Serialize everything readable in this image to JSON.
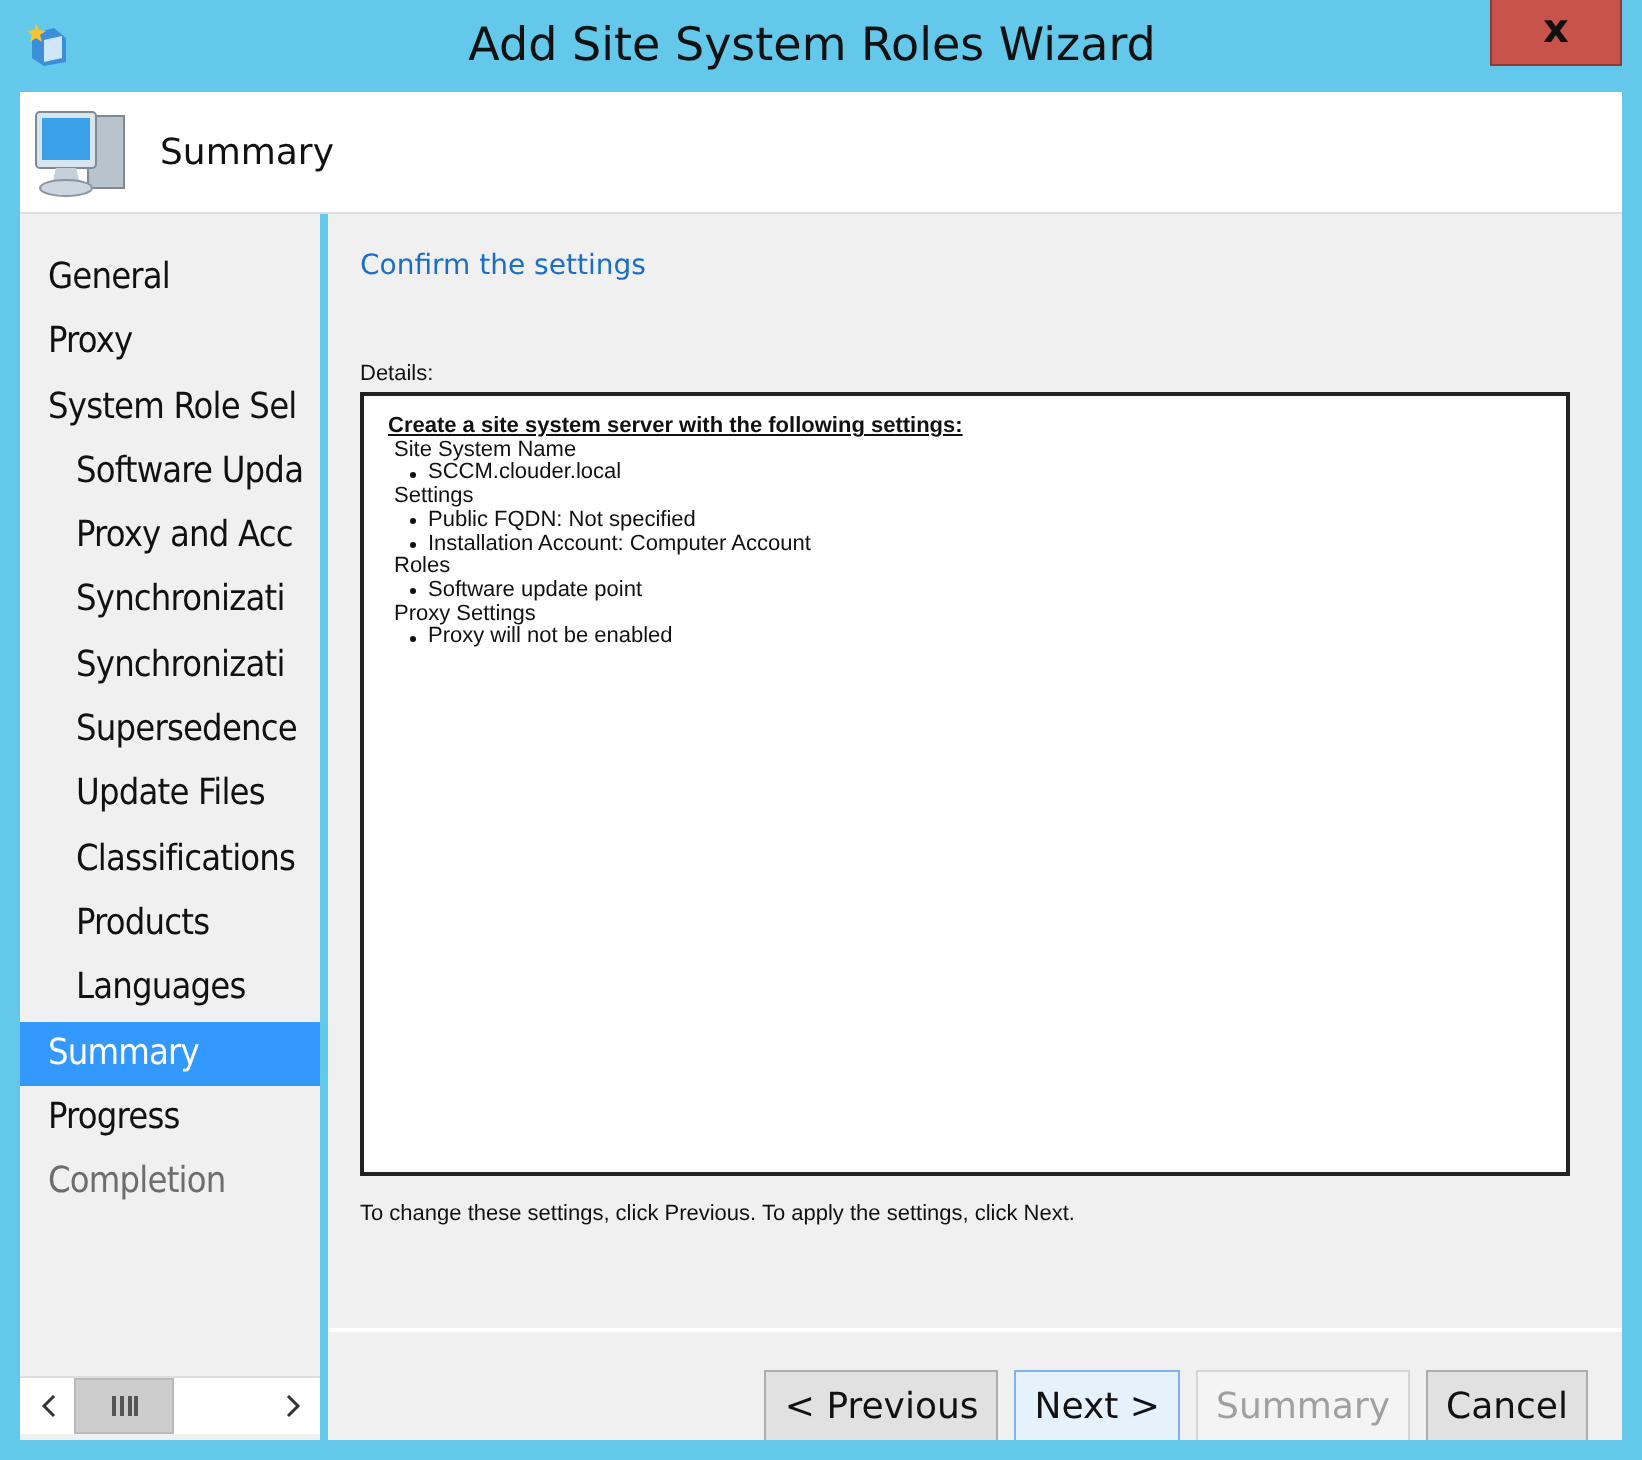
{
  "window": {
    "title": "Add Site System Roles Wizard",
    "close": "x"
  },
  "header": {
    "title": "Summary"
  },
  "sidebar": {
    "items": [
      {
        "label": "General",
        "selected": false,
        "disabled": false
      },
      {
        "label": "Proxy",
        "selected": false,
        "disabled": false
      },
      {
        "label": "System Role Sel",
        "selected": false,
        "disabled": false,
        "children": [
          {
            "label": "Software Upda",
            "selected": false,
            "disabled": false
          },
          {
            "label": "Proxy and Acc",
            "selected": false,
            "disabled": false
          },
          {
            "label": "Synchronizati",
            "selected": false,
            "disabled": false
          },
          {
            "label": "Synchronizati",
            "selected": false,
            "disabled": false
          },
          {
            "label": "Supersedence",
            "selected": false,
            "disabled": false
          },
          {
            "label": "Update Files",
            "selected": false,
            "disabled": false
          },
          {
            "label": "Classifications",
            "selected": false,
            "disabled": false
          },
          {
            "label": "Products",
            "selected": false,
            "disabled": false
          },
          {
            "label": "Languages",
            "selected": false,
            "disabled": false
          }
        ]
      },
      {
        "label": "Summary",
        "selected": true,
        "disabled": false
      },
      {
        "label": "Progress",
        "selected": false,
        "disabled": false
      },
      {
        "label": "Completion",
        "selected": false,
        "disabled": true
      }
    ]
  },
  "main": {
    "heading": "Confirm the settings",
    "details_label": "Details:",
    "details": {
      "heading": "Create a site system server with the following settings:",
      "sections": [
        {
          "title": "Site System Name",
          "items": [
            "SCCM.clouder.local"
          ]
        },
        {
          "title": "Settings",
          "items": [
            "Public FQDN: Not specified",
            "Installation Account: Computer Account"
          ]
        },
        {
          "title": "Roles",
          "items": [
            "Software update point"
          ]
        },
        {
          "title": "Proxy Settings",
          "items": [
            "Proxy will not be enabled"
          ]
        }
      ]
    },
    "note": "To change these settings, click Previous. To apply the settings, click Next."
  },
  "buttons": [
    {
      "label": "< Previous",
      "disabled": false,
      "focused": false
    },
    {
      "label": "Next >",
      "disabled": false,
      "focused": true
    },
    {
      "label": "Summary",
      "disabled": true,
      "focused": false
    },
    {
      "label": "Cancel",
      "disabled": false,
      "focused": false
    }
  ]
}
